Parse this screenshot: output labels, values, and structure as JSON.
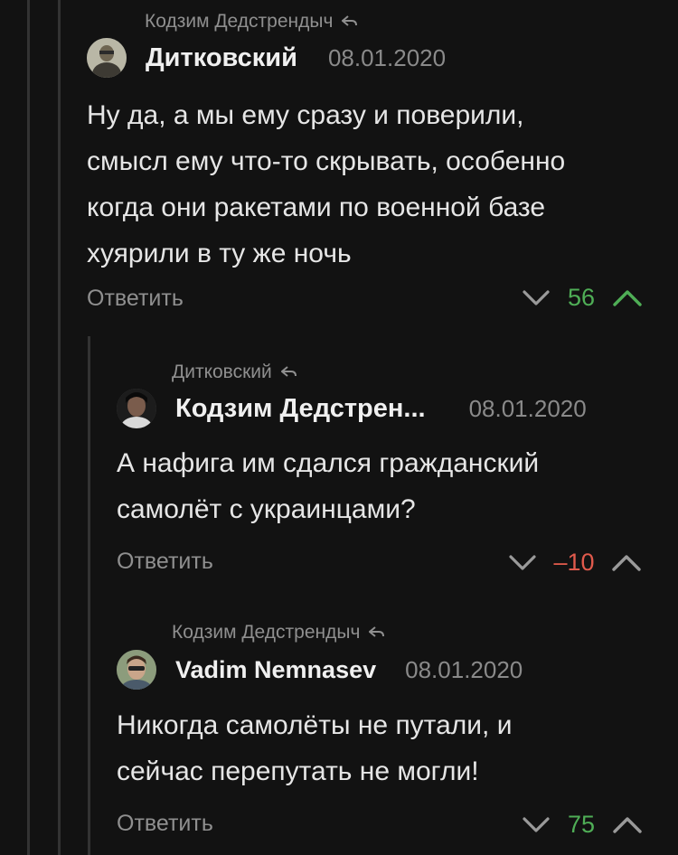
{
  "colors": {
    "background": "#121212",
    "positive": "#4fae56",
    "negative": "#e05a4c",
    "muted": "#8f8f8f"
  },
  "comments": [
    {
      "reply_to": "Кодзим Дедстрендыч",
      "author": "Дитковский",
      "date": "08.01.2020",
      "text_lines": [
        "Ну да, а мы ему сразу и поверили,",
        "смысл ему что-то скрывать, особенно",
        "когда они ракетами по военной базе",
        "хуярили в ту же ночь"
      ],
      "reply_label": "Ответить",
      "rating": "56",
      "rating_sign": "positive"
    },
    {
      "reply_to": "Дитковский",
      "author": "Кодзим Дедстрен...",
      "date": "08.01.2020",
      "text_lines": [
        "А нафига им сдался гражданский",
        "самолёт с украинцами?"
      ],
      "reply_label": "Ответить",
      "rating": "–10",
      "rating_sign": "negative"
    },
    {
      "reply_to": "Кодзим Дедстрендыч",
      "author": "Vadim Nemnasev",
      "date": "08.01.2020",
      "text_lines": [
        "Никогда самолёты не путали, и",
        "сейчас перепутать не могли!"
      ],
      "reply_label": "Ответить",
      "rating": "75",
      "rating_sign": "positive"
    }
  ]
}
